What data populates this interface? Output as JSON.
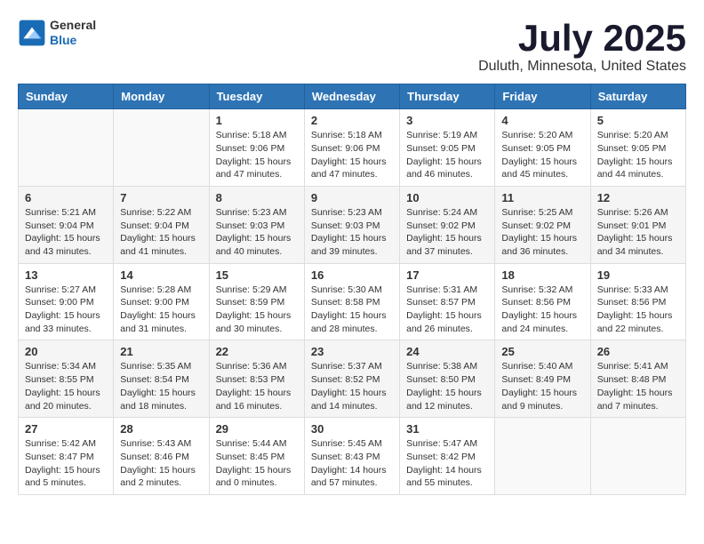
{
  "logo": {
    "general": "General",
    "blue": "Blue"
  },
  "header": {
    "month_year": "July 2025",
    "location": "Duluth, Minnesota, United States"
  },
  "weekdays": [
    "Sunday",
    "Monday",
    "Tuesday",
    "Wednesday",
    "Thursday",
    "Friday",
    "Saturday"
  ],
  "weeks": [
    [
      {
        "day": "",
        "info": ""
      },
      {
        "day": "",
        "info": ""
      },
      {
        "day": "1",
        "info": "Sunrise: 5:18 AM\nSunset: 9:06 PM\nDaylight: 15 hours and 47 minutes."
      },
      {
        "day": "2",
        "info": "Sunrise: 5:18 AM\nSunset: 9:06 PM\nDaylight: 15 hours and 47 minutes."
      },
      {
        "day": "3",
        "info": "Sunrise: 5:19 AM\nSunset: 9:05 PM\nDaylight: 15 hours and 46 minutes."
      },
      {
        "day": "4",
        "info": "Sunrise: 5:20 AM\nSunset: 9:05 PM\nDaylight: 15 hours and 45 minutes."
      },
      {
        "day": "5",
        "info": "Sunrise: 5:20 AM\nSunset: 9:05 PM\nDaylight: 15 hours and 44 minutes."
      }
    ],
    [
      {
        "day": "6",
        "info": "Sunrise: 5:21 AM\nSunset: 9:04 PM\nDaylight: 15 hours and 43 minutes."
      },
      {
        "day": "7",
        "info": "Sunrise: 5:22 AM\nSunset: 9:04 PM\nDaylight: 15 hours and 41 minutes."
      },
      {
        "day": "8",
        "info": "Sunrise: 5:23 AM\nSunset: 9:03 PM\nDaylight: 15 hours and 40 minutes."
      },
      {
        "day": "9",
        "info": "Sunrise: 5:23 AM\nSunset: 9:03 PM\nDaylight: 15 hours and 39 minutes."
      },
      {
        "day": "10",
        "info": "Sunrise: 5:24 AM\nSunset: 9:02 PM\nDaylight: 15 hours and 37 minutes."
      },
      {
        "day": "11",
        "info": "Sunrise: 5:25 AM\nSunset: 9:02 PM\nDaylight: 15 hours and 36 minutes."
      },
      {
        "day": "12",
        "info": "Sunrise: 5:26 AM\nSunset: 9:01 PM\nDaylight: 15 hours and 34 minutes."
      }
    ],
    [
      {
        "day": "13",
        "info": "Sunrise: 5:27 AM\nSunset: 9:00 PM\nDaylight: 15 hours and 33 minutes."
      },
      {
        "day": "14",
        "info": "Sunrise: 5:28 AM\nSunset: 9:00 PM\nDaylight: 15 hours and 31 minutes."
      },
      {
        "day": "15",
        "info": "Sunrise: 5:29 AM\nSunset: 8:59 PM\nDaylight: 15 hours and 30 minutes."
      },
      {
        "day": "16",
        "info": "Sunrise: 5:30 AM\nSunset: 8:58 PM\nDaylight: 15 hours and 28 minutes."
      },
      {
        "day": "17",
        "info": "Sunrise: 5:31 AM\nSunset: 8:57 PM\nDaylight: 15 hours and 26 minutes."
      },
      {
        "day": "18",
        "info": "Sunrise: 5:32 AM\nSunset: 8:56 PM\nDaylight: 15 hours and 24 minutes."
      },
      {
        "day": "19",
        "info": "Sunrise: 5:33 AM\nSunset: 8:56 PM\nDaylight: 15 hours and 22 minutes."
      }
    ],
    [
      {
        "day": "20",
        "info": "Sunrise: 5:34 AM\nSunset: 8:55 PM\nDaylight: 15 hours and 20 minutes."
      },
      {
        "day": "21",
        "info": "Sunrise: 5:35 AM\nSunset: 8:54 PM\nDaylight: 15 hours and 18 minutes."
      },
      {
        "day": "22",
        "info": "Sunrise: 5:36 AM\nSunset: 8:53 PM\nDaylight: 15 hours and 16 minutes."
      },
      {
        "day": "23",
        "info": "Sunrise: 5:37 AM\nSunset: 8:52 PM\nDaylight: 15 hours and 14 minutes."
      },
      {
        "day": "24",
        "info": "Sunrise: 5:38 AM\nSunset: 8:50 PM\nDaylight: 15 hours and 12 minutes."
      },
      {
        "day": "25",
        "info": "Sunrise: 5:40 AM\nSunset: 8:49 PM\nDaylight: 15 hours and 9 minutes."
      },
      {
        "day": "26",
        "info": "Sunrise: 5:41 AM\nSunset: 8:48 PM\nDaylight: 15 hours and 7 minutes."
      }
    ],
    [
      {
        "day": "27",
        "info": "Sunrise: 5:42 AM\nSunset: 8:47 PM\nDaylight: 15 hours and 5 minutes."
      },
      {
        "day": "28",
        "info": "Sunrise: 5:43 AM\nSunset: 8:46 PM\nDaylight: 15 hours and 2 minutes."
      },
      {
        "day": "29",
        "info": "Sunrise: 5:44 AM\nSunset: 8:45 PM\nDaylight: 15 hours and 0 minutes."
      },
      {
        "day": "30",
        "info": "Sunrise: 5:45 AM\nSunset: 8:43 PM\nDaylight: 14 hours and 57 minutes."
      },
      {
        "day": "31",
        "info": "Sunrise: 5:47 AM\nSunset: 8:42 PM\nDaylight: 14 hours and 55 minutes."
      },
      {
        "day": "",
        "info": ""
      },
      {
        "day": "",
        "info": ""
      }
    ]
  ]
}
